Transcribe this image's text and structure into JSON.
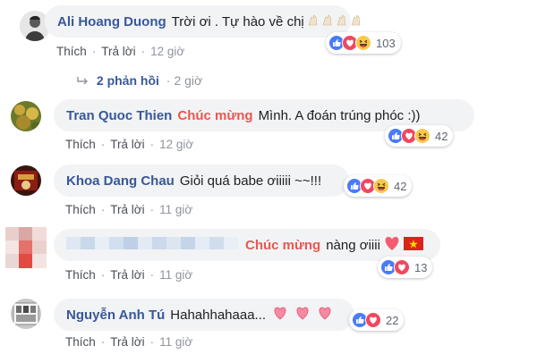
{
  "colors": {
    "link": "#385898",
    "tag": "#e9574f",
    "bubble": "#f2f3f5",
    "meta": "#90949c"
  },
  "actions": {
    "like": "Thích",
    "reply": "Trả lời"
  },
  "comments": [
    {
      "name": "Ali Hoang Duong",
      "tag": "",
      "text": "Trời ơi . Tự hào về chị",
      "time": "12 giờ",
      "reaction_count": "103",
      "reactions": [
        "like-icon",
        "love-icon",
        "haha-icon"
      ],
      "trailing": "clap-emoji-x4"
    },
    {
      "name": "Tran Quoc Thien",
      "tag": "Chúc mừng",
      "text": "Mình. A đoán trúng phóc :))",
      "time": "12 giờ",
      "reaction_count": "42",
      "reactions": [
        "like-icon",
        "love-icon",
        "haha-icon"
      ]
    },
    {
      "name": "Khoa Dang Chau",
      "tag": "",
      "text": "Giỏi quá babe ơiiiii ~~!!!",
      "time": "11 giờ",
      "reaction_count": "42",
      "reactions": [
        "like-icon",
        "love-icon",
        "haha-icon"
      ]
    },
    {
      "name": "",
      "tag": "Chúc mừng",
      "text": "nàng ơiiii",
      "time": "11 giờ",
      "reaction_count": "13",
      "reactions": [
        "like-icon",
        "love-icon"
      ],
      "trailing": "heart-and-vietnam-flag"
    },
    {
      "name": "Nguyễn Anh Tú",
      "tag": "",
      "text": "Hahahhahaaa...",
      "time": "11 giờ",
      "reaction_count": "22",
      "reactions": [
        "like-icon",
        "love-icon"
      ],
      "trailing": "hearts-x3"
    }
  ],
  "replies": {
    "label": "2 phản hồi",
    "time": "2 giờ"
  }
}
